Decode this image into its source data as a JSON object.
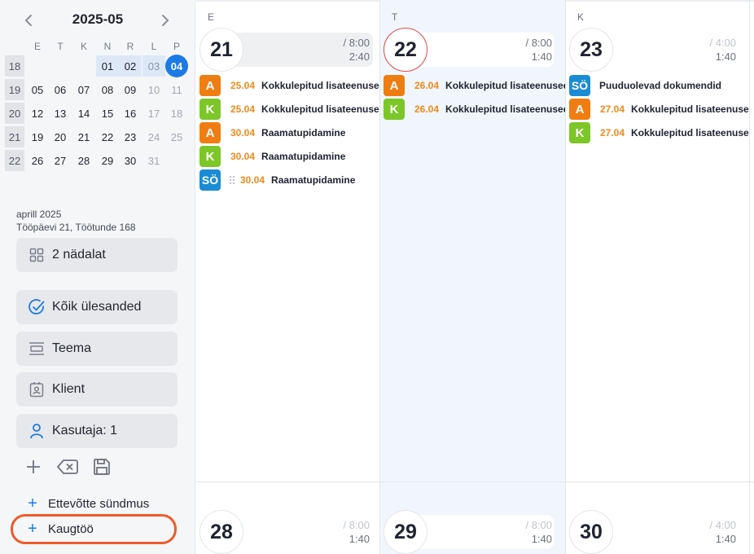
{
  "mini_calendar": {
    "title": "2025-05",
    "weekdays": [
      "E",
      "T",
      "K",
      "N",
      "R",
      "L",
      "P"
    ],
    "weeks": [
      {
        "num": "18",
        "days": [
          {
            "d": ""
          },
          {
            "d": ""
          },
          {
            "d": ""
          },
          {
            "d": "01",
            "sel": true
          },
          {
            "d": "02",
            "sel": true
          },
          {
            "d": "03",
            "sel": true,
            "muted": true
          },
          {
            "d": "04",
            "today": true
          }
        ]
      },
      {
        "num": "19",
        "days": [
          {
            "d": "05"
          },
          {
            "d": "06"
          },
          {
            "d": "07"
          },
          {
            "d": "08"
          },
          {
            "d": "09"
          },
          {
            "d": "10",
            "muted": true
          },
          {
            "d": "11",
            "muted": true
          }
        ]
      },
      {
        "num": "20",
        "days": [
          {
            "d": "12"
          },
          {
            "d": "13"
          },
          {
            "d": "14"
          },
          {
            "d": "15"
          },
          {
            "d": "16"
          },
          {
            "d": "17",
            "muted": true
          },
          {
            "d": "18",
            "muted": true
          }
        ]
      },
      {
        "num": "21",
        "days": [
          {
            "d": "19"
          },
          {
            "d": "20"
          },
          {
            "d": "21"
          },
          {
            "d": "22"
          },
          {
            "d": "23"
          },
          {
            "d": "24",
            "muted": true
          },
          {
            "d": "25",
            "muted": true
          }
        ]
      },
      {
        "num": "22",
        "days": [
          {
            "d": "26"
          },
          {
            "d": "27"
          },
          {
            "d": "28"
          },
          {
            "d": "29"
          },
          {
            "d": "30"
          },
          {
            "d": "31",
            "muted": true
          },
          {
            "d": ""
          }
        ]
      }
    ]
  },
  "month_info": {
    "line1": "aprill 2025",
    "line2": "Tööpäevi 21, Töötunde 168"
  },
  "sidebar": {
    "view_button": "2 nädalat",
    "filters": [
      "Kõik ülesanded",
      "Teema",
      "Klient",
      "Kasutaja: 1"
    ],
    "add_company_event": "Ettevõtte sündmus",
    "add_remote_work": "Kaugtöö"
  },
  "colors": {
    "accent": "#1b7ae6",
    "badge_A": "#f07d12",
    "badge_K": "#7cc628",
    "badge_SO": "#1b8cd4",
    "today_ring": "#e14848",
    "highlight": "#f05a2a"
  },
  "days": [
    {
      "dow": "E",
      "num": "21",
      "today": false,
      "planned": "/ 8:00",
      "planned_muted": false,
      "done": "2:40",
      "tasks": [
        {
          "badge": "A",
          "date": "25.04",
          "title": "Kokkulepitud lisateenused"
        },
        {
          "badge": "K",
          "date": "25.04",
          "title": "Kokkulepitud lisateenused"
        },
        {
          "badge": "A",
          "date": "30.04",
          "title": "Raamatupidamine"
        },
        {
          "badge": "K",
          "date": "30.04",
          "title": "Raamatupidamine"
        },
        {
          "badge": "SÖ",
          "date": "30.04",
          "title": "Raamatupidamine",
          "icon": "dotted-grid-icon"
        }
      ]
    },
    {
      "dow": "T",
      "num": "22",
      "today": true,
      "planned": "/ 8:00",
      "planned_muted": false,
      "done": "1:40",
      "tasks": [
        {
          "badge": "A",
          "date": "26.04",
          "title": "Kokkulepitud lisateenused"
        },
        {
          "badge": "K",
          "date": "26.04",
          "title": "Kokkulepitud lisateenused"
        }
      ]
    },
    {
      "dow": "K",
      "num": "23",
      "today": false,
      "planned": "/ 4:00",
      "planned_muted": true,
      "done": "1:40",
      "tasks": [
        {
          "badge": "SÖ",
          "date": "",
          "title": "Puuduolevad dokumendid"
        },
        {
          "badge": "A",
          "date": "27.04",
          "title": "Kokkulepitud lisateenused"
        },
        {
          "badge": "K",
          "date": "27.04",
          "title": "Kokkulepitud lisateenused"
        }
      ]
    }
  ],
  "next_week": [
    {
      "num": "28",
      "planned": "/ 8:00",
      "done": "1:40"
    },
    {
      "num": "29",
      "planned": "/ 8:00",
      "done": "1:40"
    },
    {
      "num": "30",
      "planned": "/ 4:00",
      "done": "1:40"
    }
  ]
}
